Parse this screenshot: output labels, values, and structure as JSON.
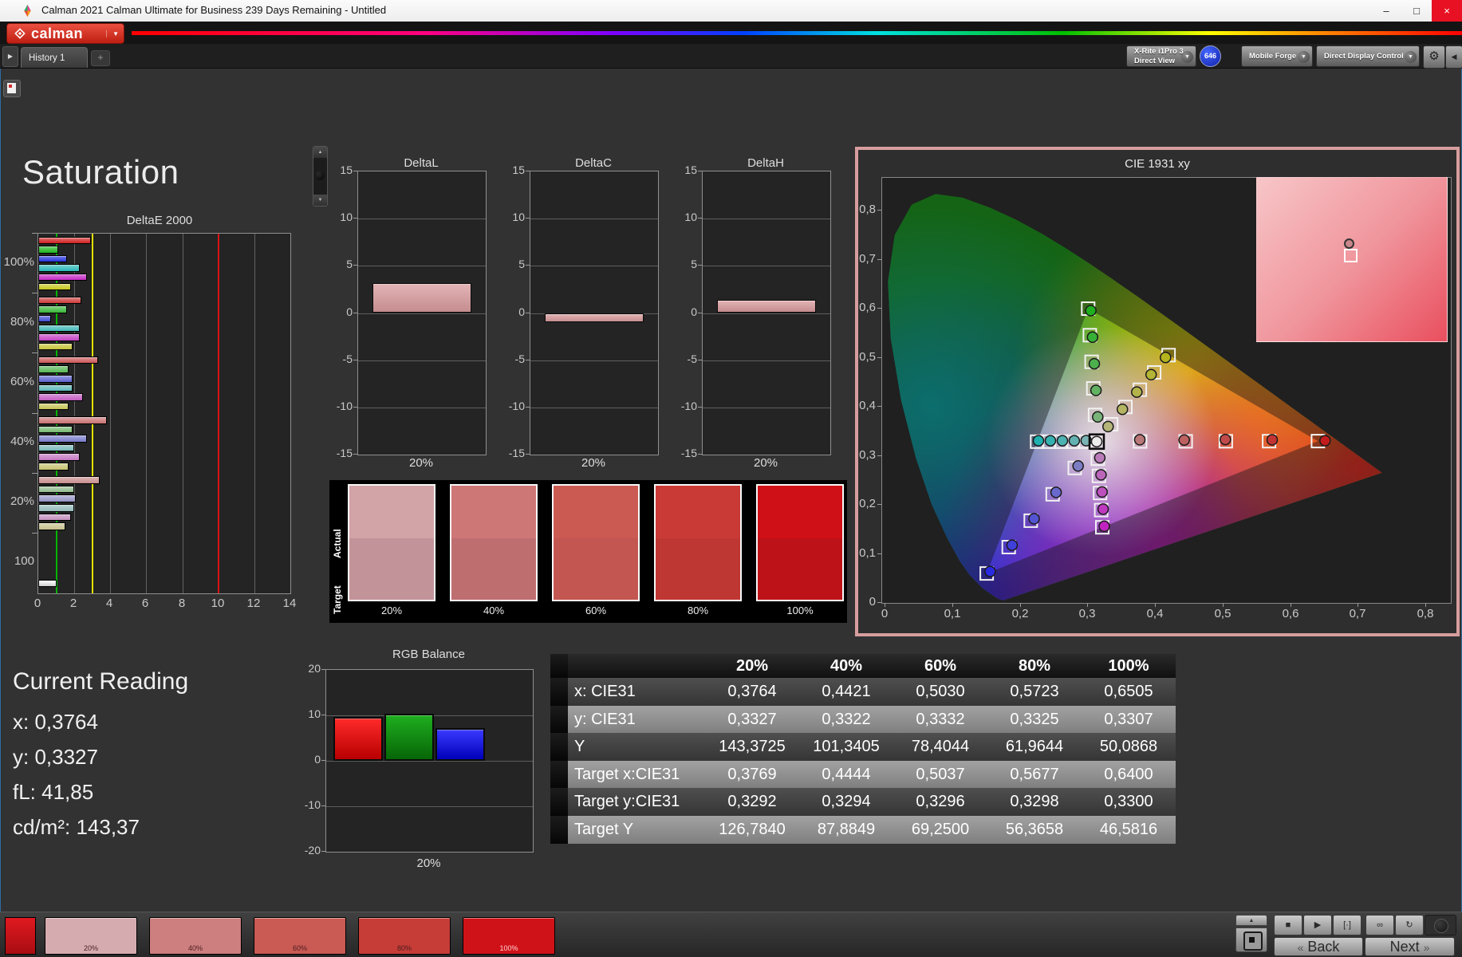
{
  "window": {
    "title": "Calman 2021 Calman Ultimate for Business 239 Days Remaining  - Untitled",
    "minimize": "–",
    "maximize": "□",
    "close": "×"
  },
  "brand": {
    "name": "calman"
  },
  "tabbar": {
    "nav": "▶",
    "history": "History 1",
    "add": "+"
  },
  "toolbar": {
    "meter": {
      "line1": "X-Rite i1Pro 3",
      "line2": "Direct View",
      "accent": "#2ecc2e",
      "badge": "646"
    },
    "source": {
      "label": "Mobile Forge",
      "accent": "#f0f0f0"
    },
    "display": {
      "label": "Direct Display Control",
      "accent": "#e8e800"
    },
    "settings_icon": "⚙",
    "collapse_icon": "◀"
  },
  "page": {
    "title": "Saturation"
  },
  "charts": {
    "deltae": {
      "type": "bar",
      "title": "DeltaE 2000",
      "xlim": [
        0,
        14
      ],
      "xticks": [
        0,
        2,
        4,
        6,
        8,
        10,
        12,
        14
      ],
      "ref_lines": {
        "green": 1,
        "yellow": 3,
        "red": 10
      },
      "series_colors": [
        "red",
        "green",
        "blue",
        "cyan",
        "magenta",
        "yellow"
      ],
      "groups": [
        {
          "label": "100%",
          "sat": 1.0,
          "values": [
            2.9,
            1.1,
            1.6,
            2.3,
            2.7,
            1.8
          ]
        },
        {
          "label": "80%",
          "sat": 0.8,
          "values": [
            2.4,
            1.6,
            0.7,
            2.3,
            2.3,
            1.9
          ]
        },
        {
          "label": "60%",
          "sat": 0.6,
          "values": [
            3.3,
            1.7,
            1.9,
            1.9,
            2.5,
            1.7
          ]
        },
        {
          "label": "40%",
          "sat": 0.4,
          "values": [
            3.8,
            1.9,
            2.7,
            2.0,
            2.3,
            1.7
          ]
        },
        {
          "label": "20%",
          "sat": 0.2,
          "values": [
            3.4,
            2.0,
            2.1,
            2.0,
            1.8,
            1.5
          ]
        },
        {
          "label": "100",
          "sat": 0.0,
          "white": true,
          "values": [
            1.0
          ]
        }
      ]
    },
    "deltaL": {
      "type": "bar",
      "title": "DeltaL",
      "value": 3.2,
      "ylim": [
        -15,
        15
      ],
      "yticks": [
        15,
        10,
        5,
        0,
        -5,
        -10,
        -15
      ],
      "xlabel": "20%"
    },
    "deltaC": {
      "type": "bar",
      "title": "DeltaC",
      "value": -1.0,
      "ylim": [
        -15,
        15
      ],
      "yticks": [
        15,
        10,
        5,
        0,
        -5,
        -10,
        -15
      ],
      "xlabel": "20%"
    },
    "deltaH": {
      "type": "bar",
      "title": "DeltaH",
      "value": 1.4,
      "ylim": [
        -15,
        15
      ],
      "yticks": [
        15,
        10,
        5,
        0,
        -5,
        -10,
        -15
      ],
      "xlabel": "20%"
    },
    "swatches": {
      "row_labels": [
        "Actual",
        "Target"
      ],
      "columns": [
        "20%",
        "40%",
        "60%",
        "80%",
        "100%"
      ],
      "actual": [
        "#d2a3a7",
        "#cd7776",
        "#cb5a53",
        "#c93a36",
        "#cf1016"
      ],
      "target": [
        "#c29399",
        "#bf6e70",
        "#c35651",
        "#bf3733",
        "#bd1318"
      ]
    },
    "cie": {
      "type": "scatter",
      "title": "CIE 1931 xy",
      "xlim": [
        0,
        0.8
      ],
      "ylim": [
        0,
        0.8
      ],
      "xticks": [
        "0",
        "0,1",
        "0,2",
        "0,3",
        "0,4",
        "0,5",
        "0,6",
        "0,7",
        "0,8"
      ],
      "yticks": [
        "0",
        "0,1",
        "0,2",
        "0,3",
        "0,4",
        "0,5",
        "0,6",
        "0,7",
        "0,8"
      ],
      "white_point": [
        0.3127,
        0.329
      ],
      "gamut_triangle": [
        [
          0.64,
          0.33
        ],
        [
          0.3,
          0.6
        ],
        [
          0.15,
          0.06
        ]
      ],
      "sweeps": [
        {
          "name": "red",
          "base": "#c41c1c",
          "targets": [
            [
              0.3769,
              0.3292
            ],
            [
              0.4444,
              0.3294
            ],
            [
              0.5037,
              0.3296
            ],
            [
              0.5677,
              0.3298
            ],
            [
              0.64,
              0.33
            ]
          ],
          "measured": [
            [
              0.3764,
              0.3327
            ],
            [
              0.4421,
              0.3322
            ],
            [
              0.503,
              0.3332
            ],
            [
              0.5723,
              0.3325
            ],
            [
              0.6505,
              0.3307
            ]
          ]
        },
        {
          "name": "green",
          "base": "#1faf1f",
          "targets": [
            [
              0.3102,
              0.3832
            ],
            [
              0.3076,
              0.4374
            ],
            [
              0.3051,
              0.4916
            ],
            [
              0.3025,
              0.5458
            ],
            [
              0.3,
              0.6
            ]
          ],
          "measured": [
            [
              0.3142,
              0.3792
            ],
            [
              0.3116,
              0.4334
            ],
            [
              0.3091,
              0.4876
            ],
            [
              0.3065,
              0.5418
            ],
            [
              0.304,
              0.596
            ]
          ]
        },
        {
          "name": "yellow",
          "base": "#b4b41e",
          "targets": [
            [
              0.334,
              0.3642
            ],
            [
              0.3552,
              0.3995
            ],
            [
              0.3765,
              0.4347
            ],
            [
              0.3977,
              0.47
            ],
            [
              0.419,
              0.5052
            ]
          ],
          "measured": [
            [
              0.3295,
              0.3595
            ],
            [
              0.3507,
              0.3948
            ],
            [
              0.372,
              0.43
            ],
            [
              0.3932,
              0.4653
            ],
            [
              0.4145,
              0.5005
            ]
          ]
        },
        {
          "name": "cyan",
          "base": "#20b0b0",
          "targets": [
            [
              0.2951,
              0.3289
            ],
            [
              0.2775,
              0.3288
            ],
            [
              0.2599,
              0.3288
            ],
            [
              0.2422,
              0.3287
            ],
            [
              0.2246,
              0.3287
            ]
          ],
          "measured": [
            [
              0.2971,
              0.3309
            ],
            [
              0.2795,
              0.3308
            ],
            [
              0.2619,
              0.3308
            ],
            [
              0.2442,
              0.3307
            ],
            [
              0.2266,
              0.3307
            ]
          ]
        },
        {
          "name": "blue",
          "base": "#2a2ae0",
          "targets": [
            [
              0.2802,
              0.2752
            ],
            [
              0.2476,
              0.2214
            ],
            [
              0.2151,
              0.1676
            ],
            [
              0.1825,
              0.1138
            ],
            [
              0.15,
              0.06
            ]
          ],
          "measured": [
            [
              0.2852,
              0.2792
            ],
            [
              0.2526,
              0.2254
            ],
            [
              0.2201,
              0.1716
            ],
            [
              0.1875,
              0.1178
            ],
            [
              0.155,
              0.064
            ]
          ]
        },
        {
          "name": "magenta",
          "base": "#c024c0",
          "targets": [
            [
              0.3143,
              0.294
            ],
            [
              0.316,
              0.2591
            ],
            [
              0.3176,
              0.2241
            ],
            [
              0.3193,
              0.1892
            ],
            [
              0.3209,
              0.1542
            ]
          ],
          "measured": [
            [
              0.3173,
              0.296
            ],
            [
              0.319,
              0.2611
            ],
            [
              0.3206,
              0.2261
            ],
            [
              0.3223,
              0.1912
            ],
            [
              0.3239,
              0.1562
            ]
          ]
        }
      ],
      "inset": {
        "circle": [
          0.485,
          0.4
        ],
        "square": [
          0.49,
          0.475
        ]
      }
    },
    "rgb_balance": {
      "type": "bar",
      "title": "RGB Balance",
      "ylim": [
        -20,
        20
      ],
      "yticks": [
        20,
        10,
        0,
        -10,
        -20
      ],
      "xlabel": "20%",
      "values": {
        "red": 9.6,
        "green": 10.3,
        "blue": 7.2
      }
    }
  },
  "current_reading": {
    "title": "Current Reading",
    "lines": [
      "x: 0,3764",
      "y: 0,3327",
      "fL: 41,85",
      "cd/m²: 143,37"
    ]
  },
  "table": {
    "columns": [
      "20%",
      "40%",
      "60%",
      "80%",
      "100%"
    ],
    "rows": [
      {
        "label": "x: CIE31",
        "values": [
          "0,3764",
          "0,4421",
          "0,5030",
          "0,5723",
          "0,6505"
        ]
      },
      {
        "label": "y: CIE31",
        "values": [
          "0,3327",
          "0,3322",
          "0,3332",
          "0,3325",
          "0,3307"
        ]
      },
      {
        "label": "Y",
        "values": [
          "143,3725",
          "101,3405",
          "78,4044",
          "61,9644",
          "50,0868"
        ]
      },
      {
        "label": "Target x:CIE31",
        "values": [
          "0,3769",
          "0,4444",
          "0,5037",
          "0,5677",
          "0,6400"
        ]
      },
      {
        "label": "Target y:CIE31",
        "values": [
          "0,3292",
          "0,3294",
          "0,3296",
          "0,3298",
          "0,3300"
        ]
      },
      {
        "label": "Target Y",
        "values": [
          "126,7840",
          "87,8849",
          "69,2500",
          "56,3658",
          "46,5816"
        ]
      }
    ]
  },
  "bottom": {
    "patches": [
      {
        "label": "20%",
        "color": "#d6abb0",
        "text": "#4a1d1f"
      },
      {
        "label": "40%",
        "color": "#cd7e7e",
        "text": "#4a1d1f"
      },
      {
        "label": "60%",
        "color": "#c95a54",
        "text": "#4a1d1f"
      },
      {
        "label": "80%",
        "color": "#c63c37",
        "text": "#4a1d1f"
      },
      {
        "label": "100%",
        "color": "#cf1218",
        "text": "#ffd2d2"
      }
    ],
    "up_icon": "▲",
    "transport": [
      "■",
      "▶",
      "[·]",
      "∞",
      "↻"
    ],
    "back_icon": "«",
    "back_label": "Back",
    "next_label": "Next",
    "next_icon": "»"
  }
}
